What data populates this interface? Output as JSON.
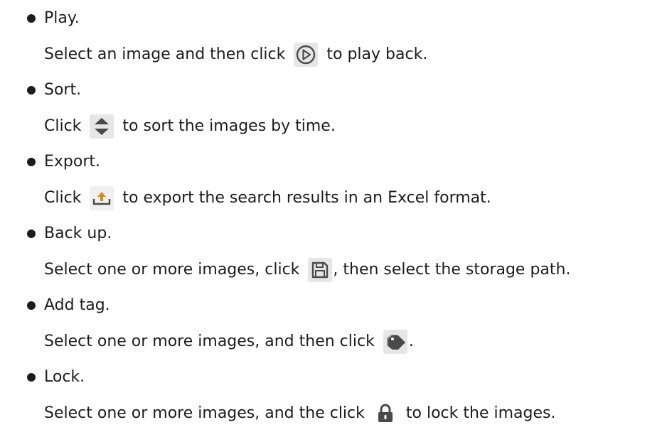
{
  "colors": {
    "text": "#1c1c1c",
    "icon_bg": "#e6e6e6",
    "icon_fg": "#4a4a4a",
    "export_accent": "#d98a1a"
  },
  "items": [
    {
      "title": "Play.",
      "desc_before": "Select an image and then click",
      "icon": "play-circle-icon",
      "desc_after": "to play back."
    },
    {
      "title": "Sort.",
      "desc_before": "Click",
      "icon": "sort-arrows-icon",
      "desc_after": "to sort the images by time."
    },
    {
      "title": "Export.",
      "desc_before": "Click",
      "icon": "export-icon",
      "desc_after": "to export the search results in an Excel format."
    },
    {
      "title": "Back up.",
      "desc_before": "Select one or more images, click",
      "icon": "save-disk-icon",
      "desc_after": ", then select the storage path."
    },
    {
      "title": "Add tag.",
      "desc_before": "Select one or more images, and then click",
      "icon": "tag-icon",
      "desc_after": "."
    },
    {
      "title": "Lock.",
      "desc_before": "Select one or more images, and the click",
      "icon": "lock-icon",
      "desc_after": "to lock the images."
    }
  ]
}
